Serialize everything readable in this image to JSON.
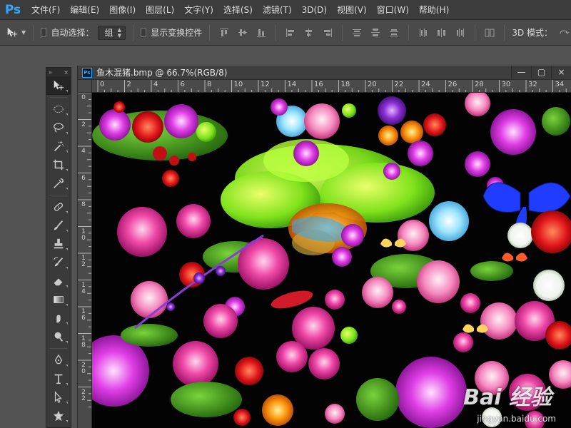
{
  "app": {
    "logo": "Ps",
    "menu": [
      "文件(F)",
      "编辑(E)",
      "图像(I)",
      "图层(L)",
      "文字(Y)",
      "选择(S)",
      "滤镜(T)",
      "3D(D)",
      "视图(V)",
      "窗口(W)",
      "帮助(H)"
    ]
  },
  "options": {
    "auto_select_label": "自动选择：",
    "auto_select_value": "组",
    "show_transform_label": "显示变换控件",
    "mode_3d_label": "3D 模式："
  },
  "toolbox": {
    "collapse": "»",
    "close": "×"
  },
  "document": {
    "title": "鱼木混猪.bmp @ 66.7%(RGB/8)",
    "ps_icon": "Ps",
    "minimize": "—",
    "restore": "▢",
    "close": "×",
    "ruler_top": [
      "0",
      "2",
      "4",
      "6",
      "8",
      "10",
      "12",
      "14",
      "16",
      "18",
      "20",
      "22",
      "24",
      "26",
      "28",
      "30",
      "32",
      "34"
    ],
    "ruler_left": [
      "0",
      "2",
      "4",
      "6",
      "8",
      "1 0",
      "1 2",
      "1 4",
      "1 6",
      "1 8",
      "2 0",
      "2 2"
    ]
  },
  "watermark": {
    "brand": "Bai 经验",
    "url": "jingyan.baidu.com"
  }
}
